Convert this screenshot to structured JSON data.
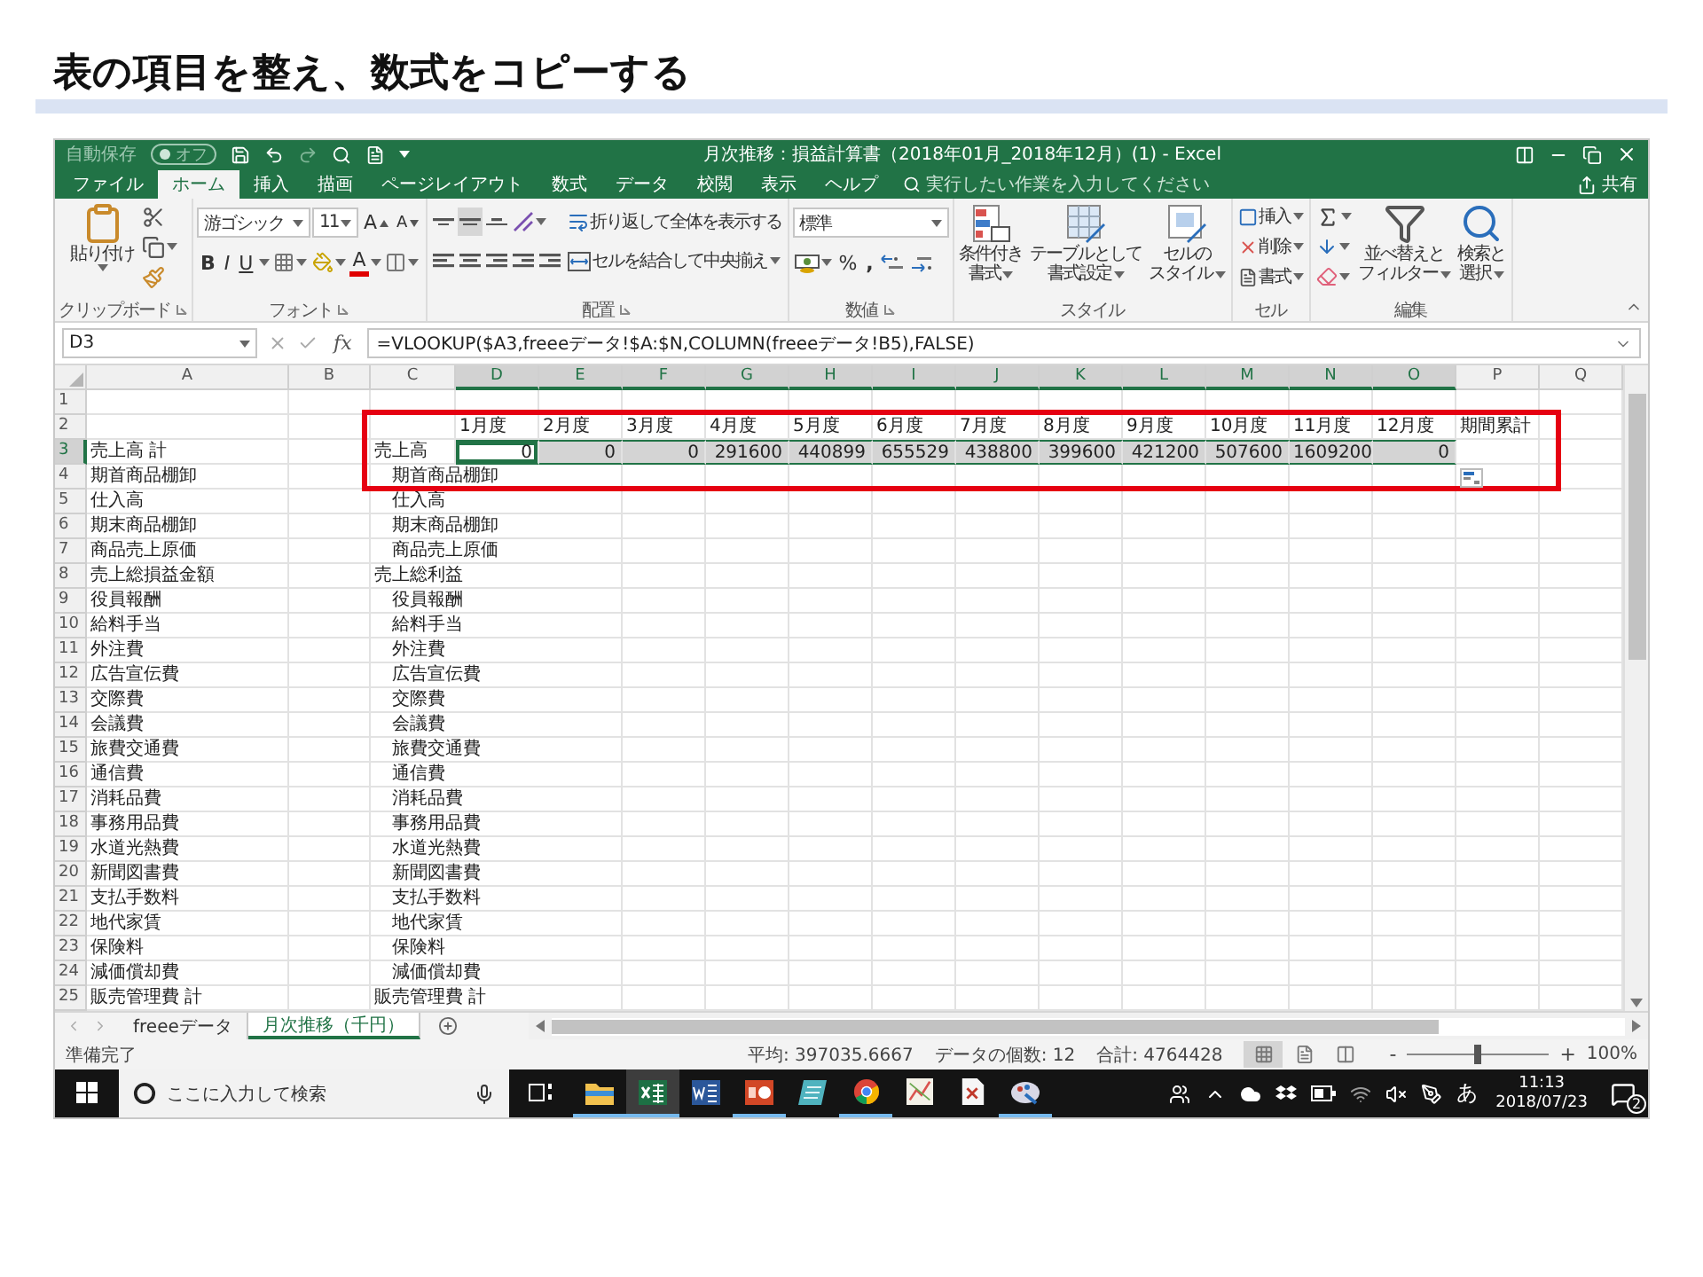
{
  "slide_title": "表の項目を整え、数式をコピーする",
  "excel": {
    "title_bar": {
      "autosave": {
        "label": "自動保存",
        "state": "オフ",
        "on": false
      },
      "title": "月次推移：損益計算書（2018年01月_2018年12月）(1)  -  Excel"
    },
    "ribbon_tabs": [
      {
        "label": "ファイル",
        "selected": false
      },
      {
        "label": "ホーム",
        "selected": true
      },
      {
        "label": "挿入",
        "selected": false
      },
      {
        "label": "描画",
        "selected": false
      },
      {
        "label": "ページレイアウト",
        "selected": false
      },
      {
        "label": "数式",
        "selected": false
      },
      {
        "label": "データ",
        "selected": false
      },
      {
        "label": "校閲",
        "selected": false
      },
      {
        "label": "表示",
        "selected": false
      },
      {
        "label": "ヘルプ",
        "selected": false
      }
    ],
    "tell_me": "実行したい作業を入力してください",
    "share": "共有",
    "ribbon_groups": [
      {
        "kind": "clipboard",
        "label": "クリップボード",
        "paste": "貼り付け"
      },
      {
        "kind": "font",
        "label": "フォント",
        "font_name": "游ゴシック",
        "font_size": "11",
        "grow": "A",
        "shrink": "A",
        "bold": "B",
        "italic": "I",
        "underline": "U",
        "font_color": "A"
      },
      {
        "kind": "alignment",
        "label": "配置",
        "wrap": "折り返して全体を表示する",
        "merge": "セルを結合して中央揃え"
      },
      {
        "kind": "number",
        "label": "数値",
        "format": "標準",
        "percent": "%",
        "comma": ","
      },
      {
        "kind": "styles",
        "label": "スタイル",
        "buttons": [
          {
            "line1": "条件付き",
            "line2": "書式"
          },
          {
            "line1": "テーブルとして",
            "line2": "書式設定"
          },
          {
            "line1": "セルの",
            "line2": "スタイル"
          }
        ]
      },
      {
        "kind": "cells",
        "label": "セル",
        "buttons": [
          "挿入",
          "削除",
          "書式"
        ]
      },
      {
        "kind": "editing",
        "label": "編集",
        "buttons": [
          {
            "line1": "並べ替えと",
            "line2": "フィルター"
          },
          {
            "line1": "検索と",
            "line2": "選択"
          }
        ]
      }
    ],
    "formula_bar": {
      "name_box": "D3",
      "fx": "fx",
      "formula": "=VLOOKUP($A3,freeeデータ!$A:$N,COLUMN(freeeデータ!B5),FALSE)"
    },
    "columns": [
      {
        "label": "A",
        "selected": false
      },
      {
        "label": "B",
        "selected": false
      },
      {
        "label": "C",
        "selected": false
      },
      {
        "label": "D",
        "selected": true
      },
      {
        "label": "E",
        "selected": true
      },
      {
        "label": "F",
        "selected": true
      },
      {
        "label": "G",
        "selected": true
      },
      {
        "label": "H",
        "selected": true
      },
      {
        "label": "I",
        "selected": true
      },
      {
        "label": "J",
        "selected": true
      },
      {
        "label": "K",
        "selected": true
      },
      {
        "label": "L",
        "selected": true
      },
      {
        "label": "M",
        "selected": true
      },
      {
        "label": "N",
        "selected": true
      },
      {
        "label": "O",
        "selected": true
      },
      {
        "label": "P",
        "selected": false
      },
      {
        "label": "Q",
        "selected": false
      }
    ],
    "rows": [
      {
        "number": "1",
        "selected": false,
        "kind": "blank"
      },
      {
        "number": "2",
        "selected": false,
        "kind": "months",
        "values": [
          "1月度",
          "2月度",
          "3月度",
          "4月度",
          "5月度",
          "6月度",
          "7月度",
          "8月度",
          "9月度",
          "10月度",
          "11月度",
          "12月度"
        ],
        "p": "期間累計"
      },
      {
        "number": "3",
        "selected": true,
        "kind": "data",
        "a": "売上高 計",
        "c": "売上高",
        "values": [
          {
            "text": "0",
            "selected": true,
            "active": true
          },
          {
            "text": "0",
            "selected": true,
            "active": false
          },
          {
            "text": "0",
            "selected": true,
            "active": false
          },
          {
            "text": "291600",
            "selected": true,
            "active": false
          },
          {
            "text": "440899",
            "selected": true,
            "active": false
          },
          {
            "text": "655529",
            "selected": true,
            "active": false
          },
          {
            "text": "438800",
            "selected": true,
            "active": false
          },
          {
            "text": "399600",
            "selected": true,
            "active": false
          },
          {
            "text": "421200",
            "selected": true,
            "active": false
          },
          {
            "text": "507600",
            "selected": true,
            "active": false
          },
          {
            "text": "1609200",
            "selected": true,
            "active": false
          },
          {
            "text": "0",
            "selected": true,
            "active": false
          }
        ]
      },
      {
        "number": "4",
        "selected": false,
        "kind": "item",
        "a": "期首商品棚卸",
        "c": "期首商品棚卸",
        "indent": true
      },
      {
        "number": "5",
        "selected": false,
        "kind": "item",
        "a": "仕入高",
        "c": "仕入高",
        "indent": true
      },
      {
        "number": "6",
        "selected": false,
        "kind": "item",
        "a": "期末商品棚卸",
        "c": "期末商品棚卸",
        "indent": true
      },
      {
        "number": "7",
        "selected": false,
        "kind": "item",
        "a": "商品売上原価",
        "c": "商品売上原価",
        "indent": true
      },
      {
        "number": "8",
        "selected": false,
        "kind": "item",
        "a": "売上総損益金額",
        "c": "売上総利益",
        "indent": false
      },
      {
        "number": "9",
        "selected": false,
        "kind": "item",
        "a": "役員報酬",
        "c": "役員報酬",
        "indent": true
      },
      {
        "number": "10",
        "selected": false,
        "kind": "item",
        "a": "給料手当",
        "c": "給料手当",
        "indent": true
      },
      {
        "number": "11",
        "selected": false,
        "kind": "item",
        "a": "外注費",
        "c": "外注費",
        "indent": true
      },
      {
        "number": "12",
        "selected": false,
        "kind": "item",
        "a": "広告宣伝費",
        "c": "広告宣伝費",
        "indent": true
      },
      {
        "number": "13",
        "selected": false,
        "kind": "item",
        "a": "交際費",
        "c": "交際費",
        "indent": true
      },
      {
        "number": "14",
        "selected": false,
        "kind": "item",
        "a": "会議費",
        "c": "会議費",
        "indent": true
      },
      {
        "number": "15",
        "selected": false,
        "kind": "item",
        "a": "旅費交通費",
        "c": "旅費交通費",
        "indent": true
      },
      {
        "number": "16",
        "selected": false,
        "kind": "item",
        "a": "通信費",
        "c": "通信費",
        "indent": true
      },
      {
        "number": "17",
        "selected": false,
        "kind": "item",
        "a": "消耗品費",
        "c": "消耗品費",
        "indent": true
      },
      {
        "number": "18",
        "selected": false,
        "kind": "item",
        "a": "事務用品費",
        "c": "事務用品費",
        "indent": true
      },
      {
        "number": "19",
        "selected": false,
        "kind": "item",
        "a": "水道光熱費",
        "c": "水道光熱費",
        "indent": true
      },
      {
        "number": "20",
        "selected": false,
        "kind": "item",
        "a": "新聞図書費",
        "c": "新聞図書費",
        "indent": true
      },
      {
        "number": "21",
        "selected": false,
        "kind": "item",
        "a": "支払手数料",
        "c": "支払手数料",
        "indent": true
      },
      {
        "number": "22",
        "selected": false,
        "kind": "item",
        "a": "地代家賃",
        "c": "地代家賃",
        "indent": true
      },
      {
        "number": "23",
        "selected": false,
        "kind": "item",
        "a": "保険料",
        "c": "保険料",
        "indent": true
      },
      {
        "number": "24",
        "selected": false,
        "kind": "item",
        "a": "減価償却費",
        "c": "減価償却費",
        "indent": true
      },
      {
        "number": "25",
        "selected": false,
        "kind": "item",
        "a": "販売管理費 計",
        "c": "販売管理費 計",
        "indent": false
      }
    ],
    "sheet_tabs": [
      {
        "label": "freeeデータ",
        "selected": false
      },
      {
        "label": "月次推移（千円）",
        "selected": true
      }
    ],
    "status_bar": {
      "ready": "準備完了",
      "average": "平均: 397035.6667",
      "count": "データの個数: 12",
      "sum": "合計: 4764428",
      "zoom": {
        "minus": "-",
        "plus": "+",
        "level": 0.5,
        "percent": "100%"
      }
    }
  },
  "taskbar": {
    "search": "ここに入力して検索",
    "apps": [
      {
        "kind": "explorer",
        "active": false,
        "running": true
      },
      {
        "kind": "excel",
        "active": true,
        "running": true
      },
      {
        "kind": "word",
        "active": false,
        "running": false
      },
      {
        "kind": "powerpoint",
        "active": false,
        "running": true
      },
      {
        "kind": "tool",
        "active": false,
        "running": false
      },
      {
        "kind": "chrome",
        "active": false,
        "running": true
      },
      {
        "kind": "chart",
        "active": false,
        "running": false
      },
      {
        "kind": "document",
        "active": false,
        "running": false
      },
      {
        "kind": "paint",
        "active": false,
        "running": true
      }
    ],
    "ime": "あ",
    "time": "11:13",
    "date": "2018/07/23",
    "notifications": "2"
  }
}
